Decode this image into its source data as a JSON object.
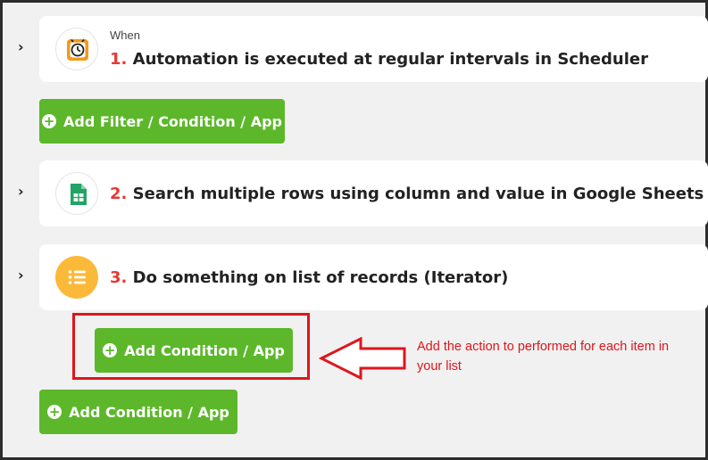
{
  "steps": [
    {
      "prefix": "When",
      "number": "1.",
      "title": "Automation is executed at regular intervals in Scheduler",
      "icon": "alarm-clock-icon"
    },
    {
      "number": "2.",
      "title": "Search multiple rows using column and value in Google Sheets",
      "icon": "google-sheets-icon"
    },
    {
      "number": "3.",
      "title": "Do something on list of records (Iterator)",
      "icon": "list-icon"
    }
  ],
  "buttons": {
    "add_filter": "Add Filter / Condition / App",
    "add_condition_inner": "Add Condition / App",
    "add_condition_outer": "Add Condition / App"
  },
  "annotation": {
    "text": "Add the action to performed for each item in your list",
    "color": "#e0151b"
  },
  "colors": {
    "accent_green": "#5cb82a",
    "step_number_red": "#e53935",
    "iterator_yellow": "#fbb93a",
    "sheets_green": "#21a464"
  }
}
